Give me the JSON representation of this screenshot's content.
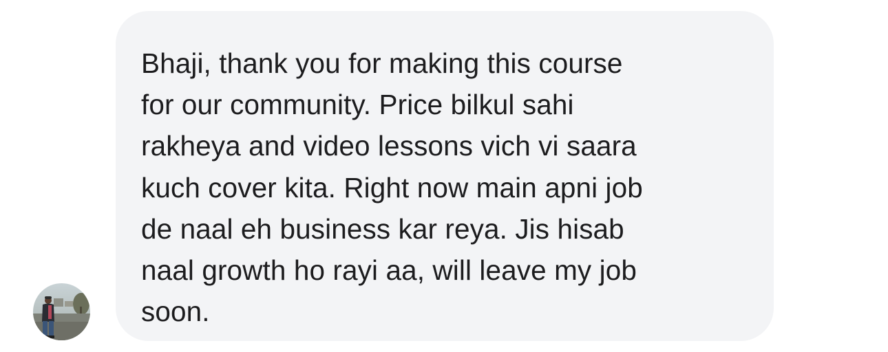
{
  "message": {
    "text": "Bhaji, thank you for making this course\nfor our community. Price bilkul sahi\nrakheya and video lessons vich vi saara\nkuch cover kita. Right now main apni job\nde naal eh business kar reya. Jis hisab\nnaal growth ho rayi aa, will leave my job\nsoon.",
    "bubble_color": "#f3f4f6",
    "text_color": "#1c1c1e"
  },
  "sender": {
    "avatar_icon": "user-avatar-photo"
  }
}
